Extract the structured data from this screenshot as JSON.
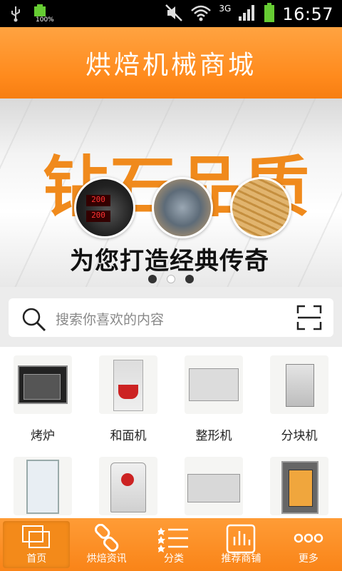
{
  "status_bar": {
    "battery_text": "100%",
    "network": "3G",
    "time": "16:57"
  },
  "header": {
    "title": "烘焙机械商城"
  },
  "banner": {
    "headline": "钻石品质",
    "slogan": "为您打造经典传奇",
    "display_values": [
      "200",
      "200"
    ],
    "dots_count": 3,
    "active_dot": 1
  },
  "search": {
    "placeholder": "搜索你喜欢的内容"
  },
  "categories": [
    {
      "label": "烤炉",
      "icon": "oven-icon"
    },
    {
      "label": "和面机",
      "icon": "dough-mixer-icon"
    },
    {
      "label": "整形机",
      "icon": "moulder-icon"
    },
    {
      "label": "分块机",
      "icon": "divider-icon"
    },
    {
      "label": "",
      "icon": "proofer-icon"
    },
    {
      "label": "",
      "icon": "planetary-mixer-icon"
    },
    {
      "label": "",
      "icon": "sheeter-icon"
    },
    {
      "label": "",
      "icon": "rack-oven-icon"
    }
  ],
  "tabbar": {
    "items": [
      {
        "label": "首页",
        "icon": "home-icon"
      },
      {
        "label": "烘焙资讯",
        "icon": "link-icon"
      },
      {
        "label": "分类",
        "icon": "list-icon"
      },
      {
        "label": "推荐商铺",
        "icon": "chart-icon"
      },
      {
        "label": "更多",
        "icon": "more-icon"
      }
    ],
    "active_index": 0
  },
  "colors": {
    "accent": "#ff8a1c",
    "headline": "#f08a1c"
  }
}
